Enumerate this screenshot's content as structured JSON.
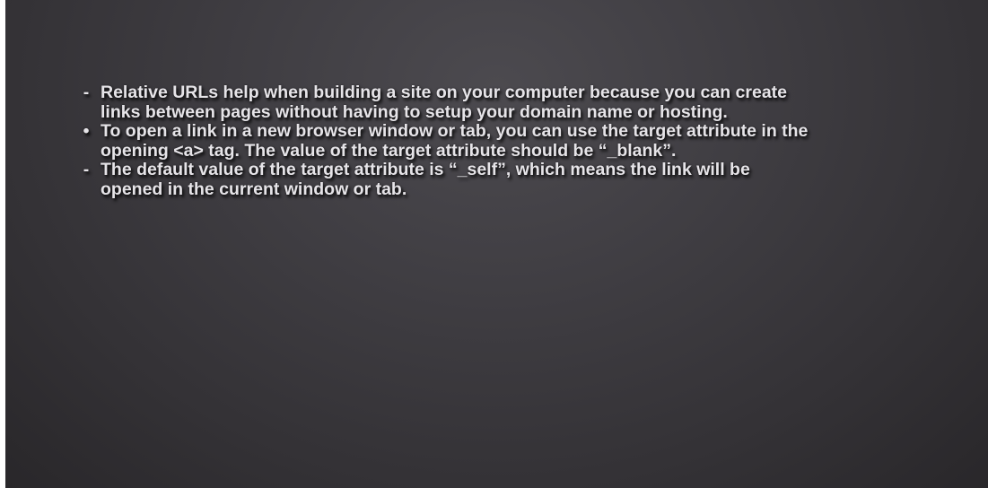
{
  "slide": {
    "bullets": [
      {
        "marker": "-",
        "lines": [
          "Relative URLs help when building a site on your computer because you can create",
          "links between pages without having to setup your domain name or hosting."
        ]
      },
      {
        "marker": "•",
        "lines": [
          "To open a link in a new browser window or tab, you can use the target attribute in the",
          "opening <a> tag. The value of the target attribute should be “_blank”."
        ]
      },
      {
        "marker": "-",
        "lines": [
          "The default value of the target attribute is “_self”, which means the link will be",
          "opened in the current window or tab."
        ]
      }
    ]
  }
}
